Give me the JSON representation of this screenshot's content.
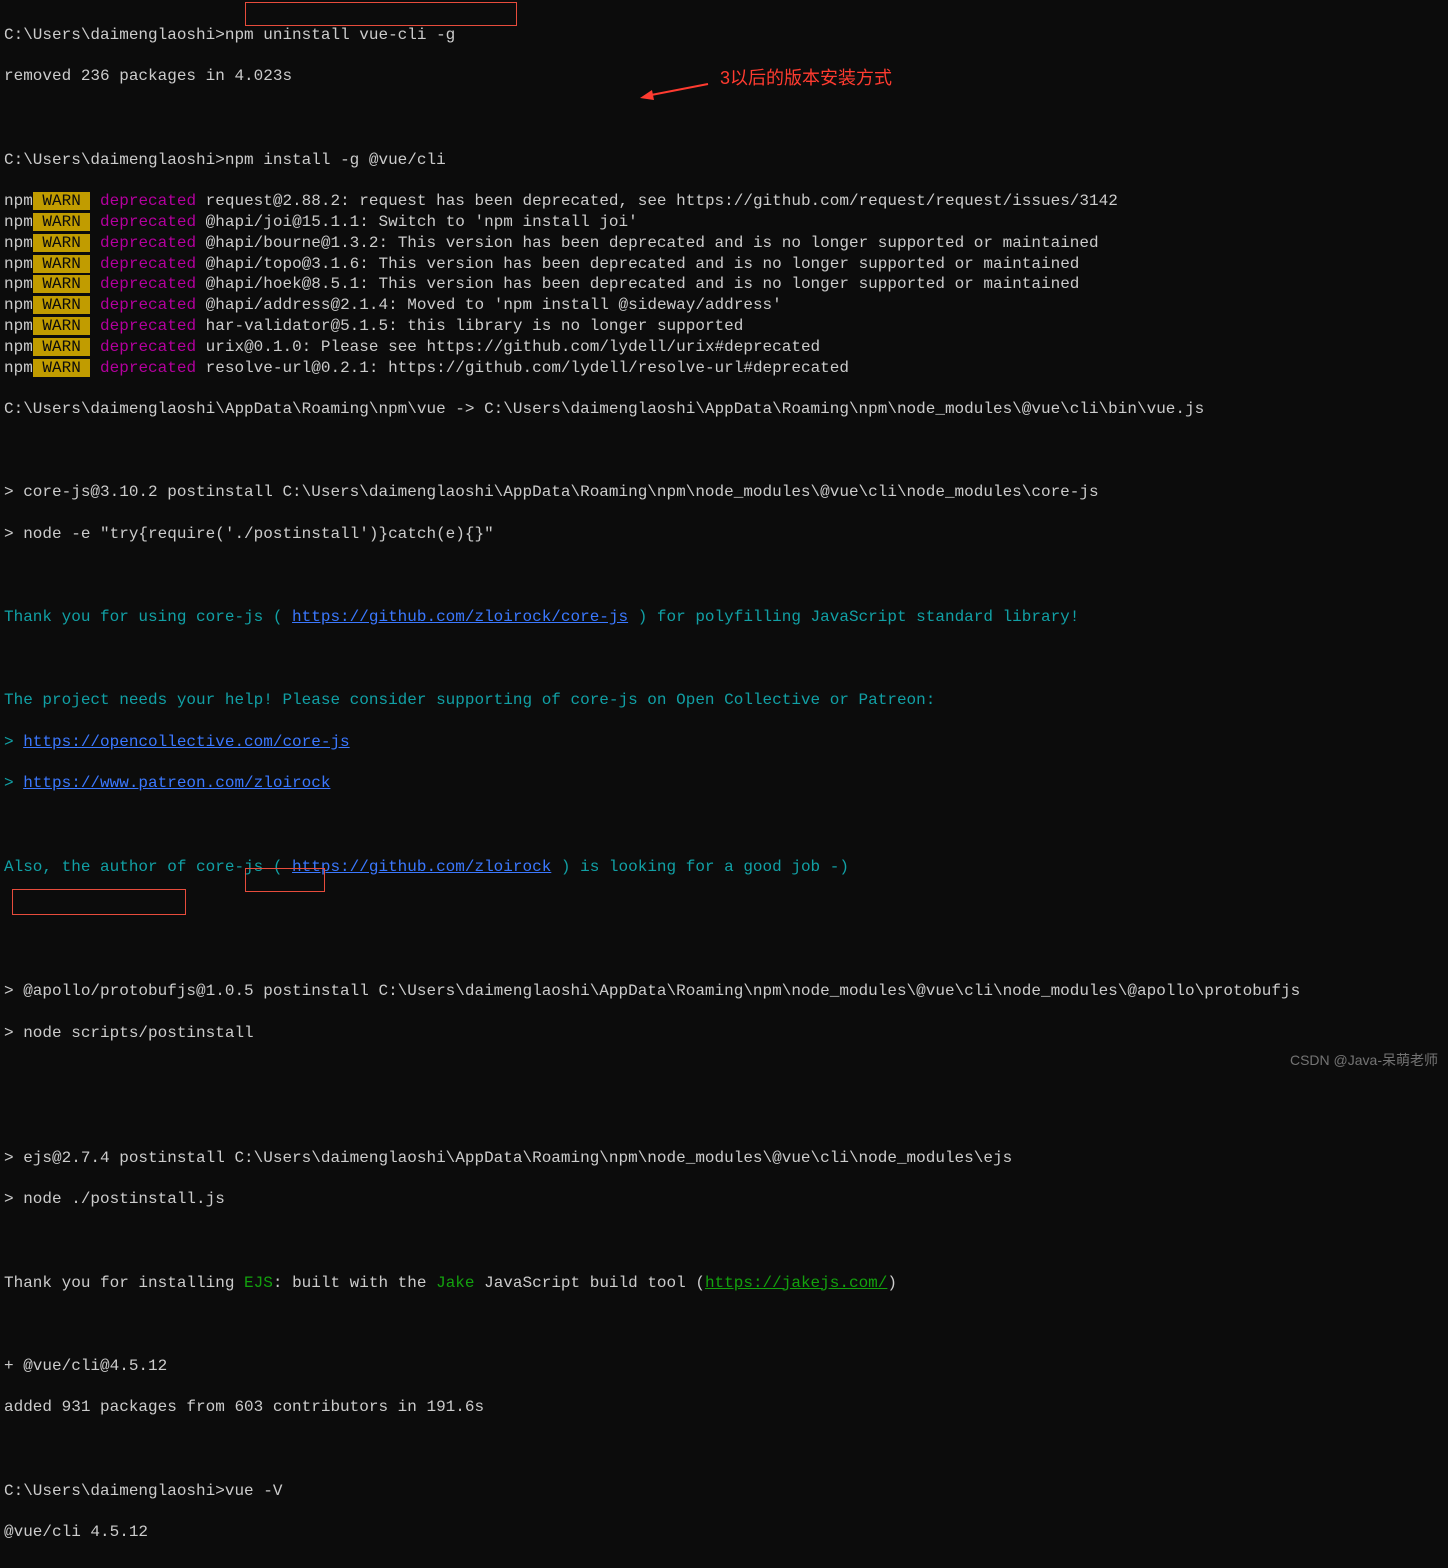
{
  "prompt_path": "C:\\Users\\daimenglaoshi>",
  "cmd_uninstall": "npm uninstall vue-cli -g",
  "removed_line": "removed 236 packages in 4.023s",
  "cmd_install": "npm install -g @vue/cli",
  "warns": [
    {
      "pkg": "request@2.88.2",
      "msg": ": request has been deprecated, see https://github.com/request/request/issues/3142"
    },
    {
      "pkg": "@hapi/joi@15.1.1",
      "msg": ": Switch to 'npm install joi'"
    },
    {
      "pkg": "@hapi/bourne@1.3.2",
      "msg": ": This version has been deprecated and is no longer supported or maintained"
    },
    {
      "pkg": "@hapi/topo@3.1.6",
      "msg": ": This version has been deprecated and is no longer supported or maintained"
    },
    {
      "pkg": "@hapi/hoek@8.5.1",
      "msg": ": This version has been deprecated and is no longer supported or maintained"
    },
    {
      "pkg": "@hapi/address@2.1.4",
      "msg": ": Moved to 'npm install @sideway/address'"
    },
    {
      "pkg": "har-validator@5.1.5",
      "msg": ": this library is no longer supported"
    },
    {
      "pkg": "urix@0.1.0",
      "msg": ": Please see https://github.com/lydell/urix#deprecated"
    },
    {
      "pkg": "resolve-url@0.2.1",
      "msg": ": https://github.com/lydell/resolve-url#deprecated"
    }
  ],
  "link_line": "C:\\Users\\daimenglaoshi\\AppData\\Roaming\\npm\\vue -> C:\\Users\\daimenglaoshi\\AppData\\Roaming\\npm\\node_modules\\@vue\\cli\\bin\\vue.js",
  "corejs_post": "> core-js@3.10.2 postinstall C:\\Users\\daimenglaoshi\\AppData\\Roaming\\npm\\node_modules\\@vue\\cli\\node_modules\\core-js",
  "corejs_node": "> node -e \"try{require('./postinstall')}catch(e){}\"",
  "corejs_thank_pre": "Thank you for using core-js ( ",
  "corejs_thank_link": "https://github.com/zloirock/core-js",
  "corejs_thank_post": " ) for polyfilling JavaScript standard library!",
  "corejs_help": "The project needs your help! Please consider supporting of core-js on Open Collective or Patreon:",
  "corejs_oc": "https://opencollective.com/core-js",
  "corejs_pat": "https://www.patreon.com/zloirock",
  "corejs_author_pre": "Also, the author of core-js ( ",
  "corejs_author_link": "https://github.com/zloirock",
  "corejs_author_post": " ) is looking for a good job -)",
  "apollo_post": "> @apollo/protobufjs@1.0.5 postinstall C:\\Users\\daimenglaoshi\\AppData\\Roaming\\npm\\node_modules\\@vue\\cli\\node_modules\\@apollo\\protobufjs",
  "apollo_node": "> node scripts/postinstall",
  "ejs_post": "> ejs@2.7.4 postinstall C:\\Users\\daimenglaoshi\\AppData\\Roaming\\npm\\node_modules\\@vue\\cli\\node_modules\\ejs",
  "ejs_node": "> node ./postinstall.js",
  "ejs_thank_pre": "Thank you for installing ",
  "ejs_name": "EJS",
  "ejs_built": ": built with the ",
  "jake_name": "Jake",
  "ejs_tool": " JavaScript build tool (",
  "jake_link": "https://jakejs.com/",
  "ejs_close": ")",
  "added_cli": "+ @vue/cli@4.5.12",
  "added_pkgs": "added 931 packages from 603 contributors in 191.6s",
  "cmd_version": "vue -V",
  "version_out": "@vue/cli 4.5.12",
  "npm_label": "npm",
  "warn_label": " WARN ",
  "deprecated_label": "deprecated",
  "arrow_prefix": "> ",
  "annotation_text": "3以后的版本安装方式",
  "watermark": "CSDN @Java-呆萌老师"
}
